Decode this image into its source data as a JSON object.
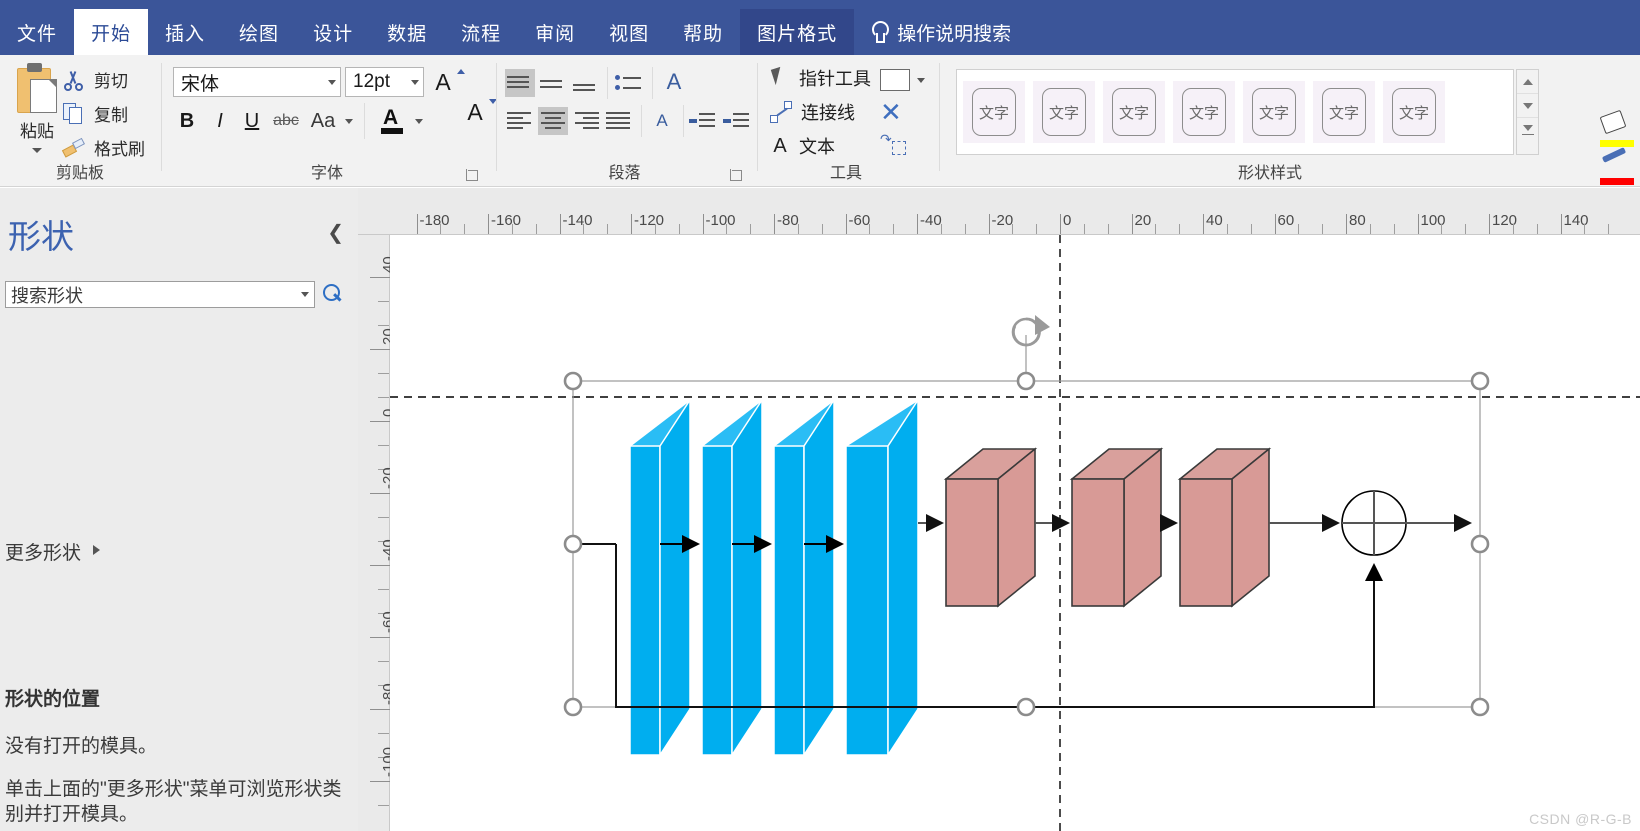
{
  "app": {
    "tabs": [
      {
        "label": "文件",
        "state": "file"
      },
      {
        "label": "开始",
        "state": "active"
      },
      {
        "label": "插入",
        "state": "normal"
      },
      {
        "label": "绘图",
        "state": "normal"
      },
      {
        "label": "设计",
        "state": "normal"
      },
      {
        "label": "数据",
        "state": "normal"
      },
      {
        "label": "流程",
        "state": "normal"
      },
      {
        "label": "审阅",
        "state": "normal"
      },
      {
        "label": "视图",
        "state": "normal"
      },
      {
        "label": "帮助",
        "state": "normal"
      },
      {
        "label": "图片格式",
        "state": "contextual"
      }
    ],
    "tell_me": "操作说明搜索",
    "tell_me_icon": "lightbulb-icon"
  },
  "ribbon": {
    "clipboard": {
      "title": "剪贴板",
      "paste_label": "粘贴",
      "paste_icon": "clipboard-icon",
      "cut_label": "剪切",
      "cut_icon": "scissors-icon",
      "copy_label": "复制",
      "copy_icon": "copy-icon",
      "format_painter_label": "格式刷",
      "format_painter_icon": "paintbrush-icon"
    },
    "font": {
      "title": "字体",
      "family_value": "宋体",
      "size_value": "12pt",
      "grow_icon": "grow-font-icon",
      "shrink_icon": "shrink-font-icon",
      "bold_label": "B",
      "italic_label": "I",
      "underline_label": "U",
      "strike_label": "abc",
      "case_label": "Aa",
      "font_color_label": "A",
      "font_color": "#111111"
    },
    "paragraph": {
      "title": "段落",
      "align_top_icon": "align-top-icon",
      "align_middle_icon": "align-middle-icon",
      "align_bottom_icon": "align-bottom-icon",
      "bullets_icon": "bullets-icon",
      "text_rotate_icon": "text-direction-icon",
      "align_left_icon": "align-left-icon",
      "align_center_icon": "align-center-icon",
      "align_right_icon": "align-right-icon",
      "align_justify_icon": "align-justify-icon",
      "line_spacing_icon": "line-spacing-icon",
      "decrease_indent_icon": "decrease-indent-icon",
      "increase_indent_icon": "increase-indent-icon"
    },
    "tools": {
      "title": "工具",
      "pointer_label": "指针工具",
      "pointer_icon": "cursor-icon",
      "connector_label": "连接线",
      "connector_icon": "connector-icon",
      "text_label": "文本",
      "text_icon": "text-A-icon",
      "rect_icon": "rectangle-tool-icon",
      "rect_caret_icon": "chevron-down-icon",
      "pointer_x_icon": "close-x-icon",
      "position_icon": "position-tool-icon"
    },
    "shape_styles": {
      "title": "形状样式",
      "thumbs": [
        "文字",
        "文字",
        "文字",
        "文字",
        "文字",
        "文字",
        "文字"
      ],
      "scroll_up_icon": "scroll-up-icon",
      "scroll_down_icon": "scroll-down-icon",
      "more_icon": "gallery-more-icon",
      "fill_icon": "shape-fill-icon",
      "fill_color": "#ffff00",
      "line_icon": "shape-outline-icon",
      "line_color": "#ff0000",
      "effects_icon": "shape-effects-icon"
    }
  },
  "shapes_panel": {
    "title": "形状",
    "collapse_icon": "chevron-left-icon",
    "search_placeholder": "搜索形状",
    "search_dropdown_icon": "chevron-down-icon",
    "search_icon": "search-icon",
    "more_shapes_label": "更多形状",
    "more_shapes_arrow_icon": "chevron-right-icon",
    "position_heading": "形状的位置",
    "position_line1": "没有打开的模具。",
    "position_line2": "单击上面的\"更多形状\"菜单可浏览形状类别并打开模具。"
  },
  "rulers": {
    "horizontal_labels": [
      "-180",
      "-160",
      "-140",
      "-120",
      "-100",
      "-80",
      "-60",
      "-40",
      "-20",
      "0",
      "20",
      "40",
      "60",
      "80",
      "100",
      "120",
      "140"
    ],
    "horizontal_start": -180,
    "horizontal_step": 20,
    "vertical_labels": [
      "40",
      "20",
      "0",
      "-20",
      "-40",
      "-60",
      "-80",
      "-100"
    ],
    "vertical_start": 40,
    "vertical_step": -20,
    "unit": "mm"
  },
  "canvas": {
    "watermark": "CSDN @R-G-B",
    "selection": {
      "rotation_handle_icon": "rotate-handle-icon",
      "handle_icon": "selection-handle-icon",
      "handle_count": 6
    },
    "diagram": {
      "type": "neural-network-block-diagram",
      "conv_layer_color": "#00AEEF",
      "conv_layer_top_color": "#2ABDF5",
      "conv_layer_side_color": "#18B6F2",
      "block_color": "#D89A96",
      "block_top_color": "#D9A09C",
      "block_outline": "#3a3a3a",
      "conv_layer_count": 4,
      "block_count": 3,
      "sum_node_icon": "summation-circle-icon",
      "skip_connection": true,
      "arrow_color": "#000000"
    }
  }
}
